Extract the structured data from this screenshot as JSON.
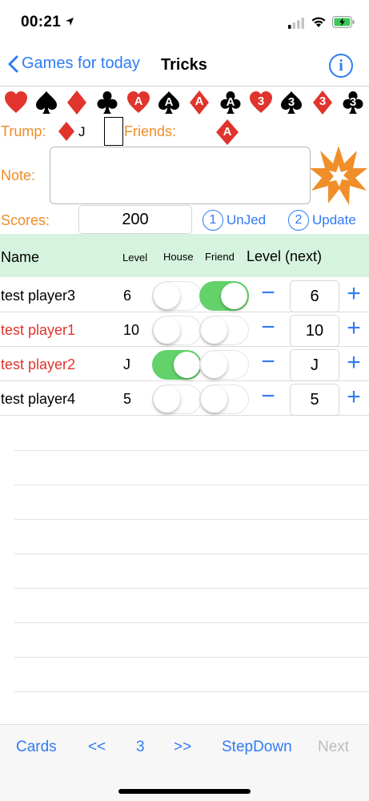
{
  "status_bar": {
    "time": "00:21"
  },
  "nav": {
    "back_label": "Games for today",
    "title": "Tricks",
    "info_icon": "i"
  },
  "cards": [
    {
      "suit": "heart",
      "label": "",
      "color": "#e0342c"
    },
    {
      "suit": "spade",
      "label": "",
      "color": "#000000"
    },
    {
      "suit": "diamond",
      "label": "",
      "color": "#e0342c"
    },
    {
      "suit": "club",
      "label": "",
      "color": "#000000"
    },
    {
      "suit": "heart",
      "label": "A",
      "color": "#e0342c"
    },
    {
      "suit": "spade",
      "label": "A",
      "color": "#000000"
    },
    {
      "suit": "diamond",
      "label": "A",
      "color": "#e0342c"
    },
    {
      "suit": "club",
      "label": "A",
      "color": "#000000"
    },
    {
      "suit": "heart",
      "label": "3",
      "color": "#e0342c"
    },
    {
      "suit": "spade",
      "label": "3",
      "color": "#000000"
    },
    {
      "suit": "diamond",
      "label": "3",
      "color": "#e0342c"
    },
    {
      "suit": "club",
      "label": "3",
      "color": "#000000"
    }
  ],
  "trump": {
    "label": "Trump:",
    "suit": "diamond",
    "level": "J"
  },
  "friends": {
    "label": "Friends:",
    "card_label": "A",
    "card_suit": "diamond"
  },
  "note": {
    "label": "Note:",
    "value": ""
  },
  "scores": {
    "label": "Scores:",
    "value": "200",
    "unjed_num": "1",
    "unjed_label": "UnJed",
    "update_num": "2",
    "update_label": "Update"
  },
  "table": {
    "headers": {
      "name": "Name",
      "level": "Level",
      "house": "House",
      "friend": "Friend",
      "next": "Level (next)"
    },
    "rows": [
      {
        "name": "test player3",
        "name_color": "black",
        "level": "6",
        "house": false,
        "friend": true,
        "next": "6"
      },
      {
        "name": "test player1",
        "name_color": "red",
        "level": "10",
        "house": false,
        "friend": false,
        "next": "10"
      },
      {
        "name": "test player2",
        "name_color": "red",
        "level": "J",
        "house": true,
        "friend": false,
        "next": "J"
      },
      {
        "name": "test player4",
        "name_color": "black",
        "level": "5",
        "house": false,
        "friend": false,
        "next": "5"
      }
    ],
    "minus_symbol": "−",
    "plus_symbol": "+"
  },
  "toolbar": {
    "cards": "Cards",
    "prev": "<<",
    "page": "3",
    "next_page": ">>",
    "stepdown": "StepDown",
    "next": "Next"
  },
  "colors": {
    "accent": "#2f7bf5",
    "orange": "#ee8d25",
    "red": "#e0342c",
    "toggle_on": "#63d26b",
    "header_bg": "#d6f3df"
  }
}
